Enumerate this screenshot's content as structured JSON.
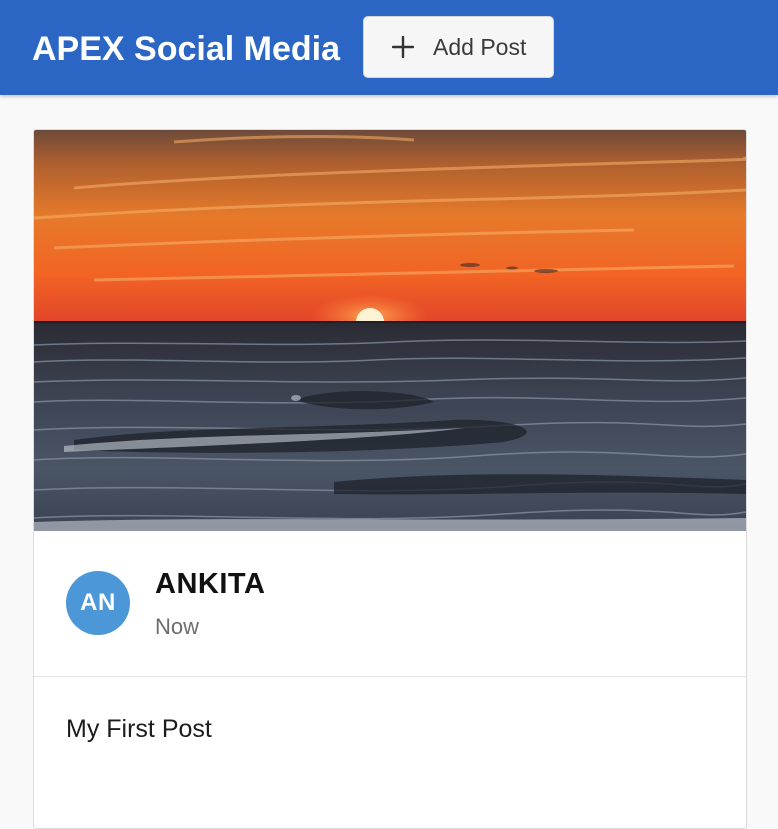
{
  "header": {
    "title": "APEX Social Media",
    "add_button_label": "Add Post",
    "add_button_icon": "plus-icon",
    "background_color": "#2b66c4"
  },
  "post": {
    "image_description": "sunset-over-sea-photo",
    "avatar_initials": "AN",
    "avatar_color": "#4c97d8",
    "author": "ANKITA",
    "time": "Now",
    "text": "My First Post"
  }
}
